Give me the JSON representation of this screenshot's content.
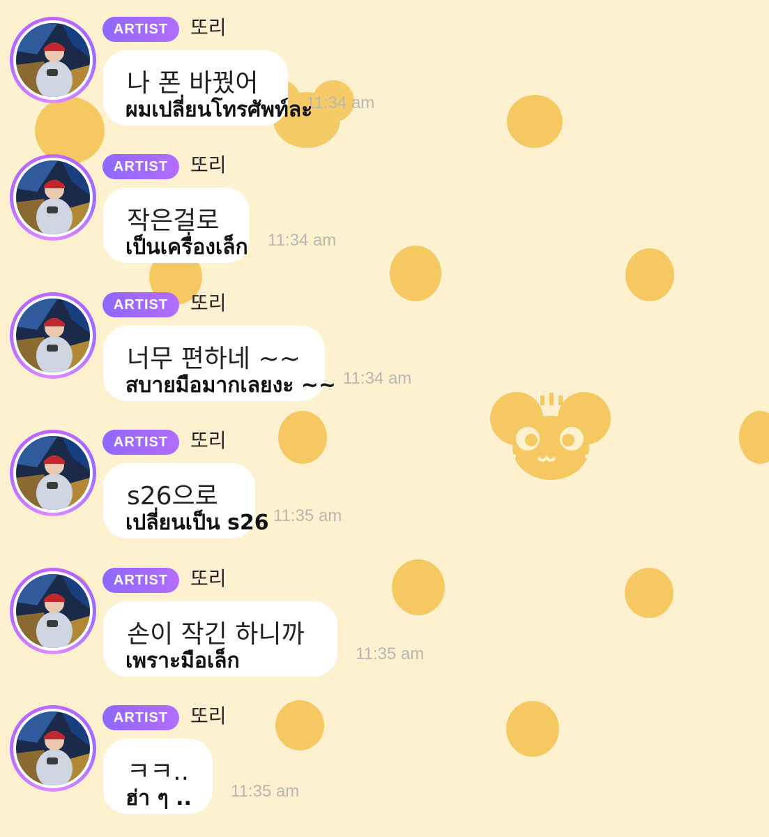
{
  "messages": [
    {
      "badge": "ARTIST",
      "username": "또리",
      "korean": "나 폰 바꿨어",
      "thai": "ผมเปลี่ยนโทรศัพท์ละ",
      "time": "11:34 am"
    },
    {
      "badge": "ARTIST",
      "username": "또리",
      "korean": "작은걸로",
      "thai": "เป็นเครื่องเล็ก",
      "time": "11:34 am"
    },
    {
      "badge": "ARTIST",
      "username": "또리",
      "korean": "너무 편하네 ~~",
      "thai": "สบายมือมากเลยงะ ~~",
      "time": "11:34 am"
    },
    {
      "badge": "ARTIST",
      "username": "또리",
      "korean": "s26으로",
      "thai": "เปลี่ยนเป็น s26",
      "time": "11:35 am"
    },
    {
      "badge": "ARTIST",
      "username": "또리",
      "korean": "손이 작긴 하니까",
      "thai": "เพราะมือเล็ก",
      "time": "11:35 am"
    },
    {
      "badge": "ARTIST",
      "username": "또리",
      "korean": "ㅋㅋ..",
      "thai": "ฮ่า ๆ ..",
      "time": "11:35 am"
    }
  ],
  "colors": {
    "background": "#fdf1cf",
    "pattern": "#f5c660",
    "badge_start": "#8f67ff",
    "badge_end": "#b36cff",
    "bubble": "#ffffff",
    "time_text": "#b8b8b0"
  },
  "icons": [
    "avatar-photo",
    "mouse-mascot-pattern"
  ]
}
